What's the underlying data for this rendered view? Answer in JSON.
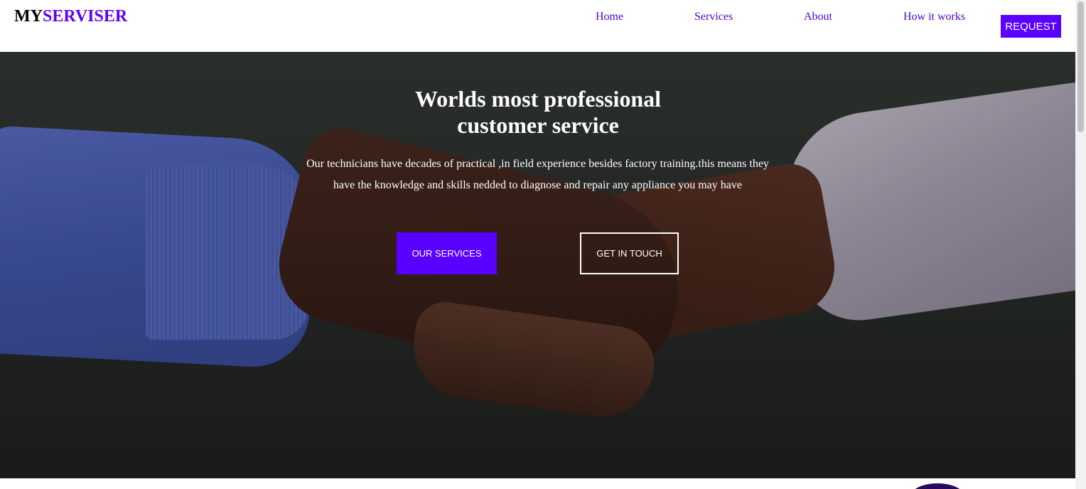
{
  "brand": {
    "part1": "MY",
    "part2": "SERVISER"
  },
  "nav": {
    "items": [
      "Home",
      "Services",
      "About",
      "How it works"
    ],
    "request_label": "REQUEST"
  },
  "hero": {
    "title_line1": "Worlds most professional",
    "title_line2": "customer service",
    "description": "Our technicians have decades of practical ,in field experience besides factory training.this means they have the knowledge and skills nedded to diagnose and repair any appliance you may have",
    "primary_button": "OUR SERVICES",
    "secondary_button": "GET IN TOUCH"
  },
  "colors": {
    "accent": "#5a00ff",
    "nav_link": "#4b00d6",
    "text_on_dark": "#ffffff"
  }
}
